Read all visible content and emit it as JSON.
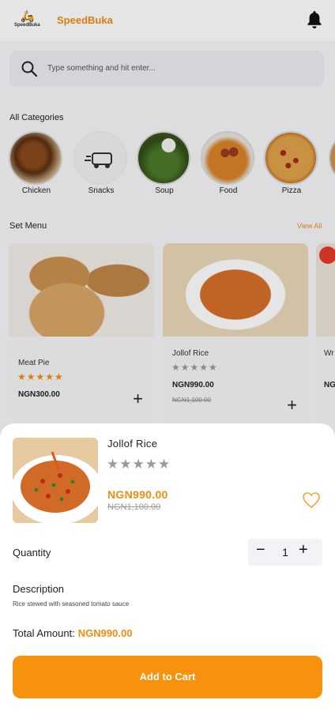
{
  "header": {
    "logo_text": "SpeedBuka",
    "brand": "SpeedBuka"
  },
  "search": {
    "placeholder": "Type something and hit enter..."
  },
  "categories": {
    "title": "All Categories",
    "items": [
      {
        "label": "Chicken"
      },
      {
        "label": "Snacks"
      },
      {
        "label": "Soup"
      },
      {
        "label": "Food"
      },
      {
        "label": "Pizza"
      }
    ]
  },
  "set_menu": {
    "title": "Set Menu",
    "view_all": "View All",
    "items": [
      {
        "name": "Meat Pie",
        "stars": "★★★★★",
        "price": "NGN300.00"
      },
      {
        "name": "Jollof Rice",
        "stars": "★★★★★",
        "price": "NGN990.00",
        "old_price": "NGN1,100.00"
      },
      {
        "name": "Wr",
        "price": "NG"
      }
    ]
  },
  "product": {
    "name": "Jollof Rice",
    "stars": "★★★★★",
    "price": "NGN990.00",
    "old_price": "NGN1,100.00",
    "quantity_label": "Quantity",
    "quantity": "1",
    "description_label": "Description",
    "description": "Rice stewed with seasoned tomato sauce",
    "total_label": "Total Amount:",
    "total": "NGN990.00",
    "add_to_cart": "Add to Cart"
  },
  "colors": {
    "accent": "#f7920f",
    "star_inactive": "#9a9a9a"
  }
}
